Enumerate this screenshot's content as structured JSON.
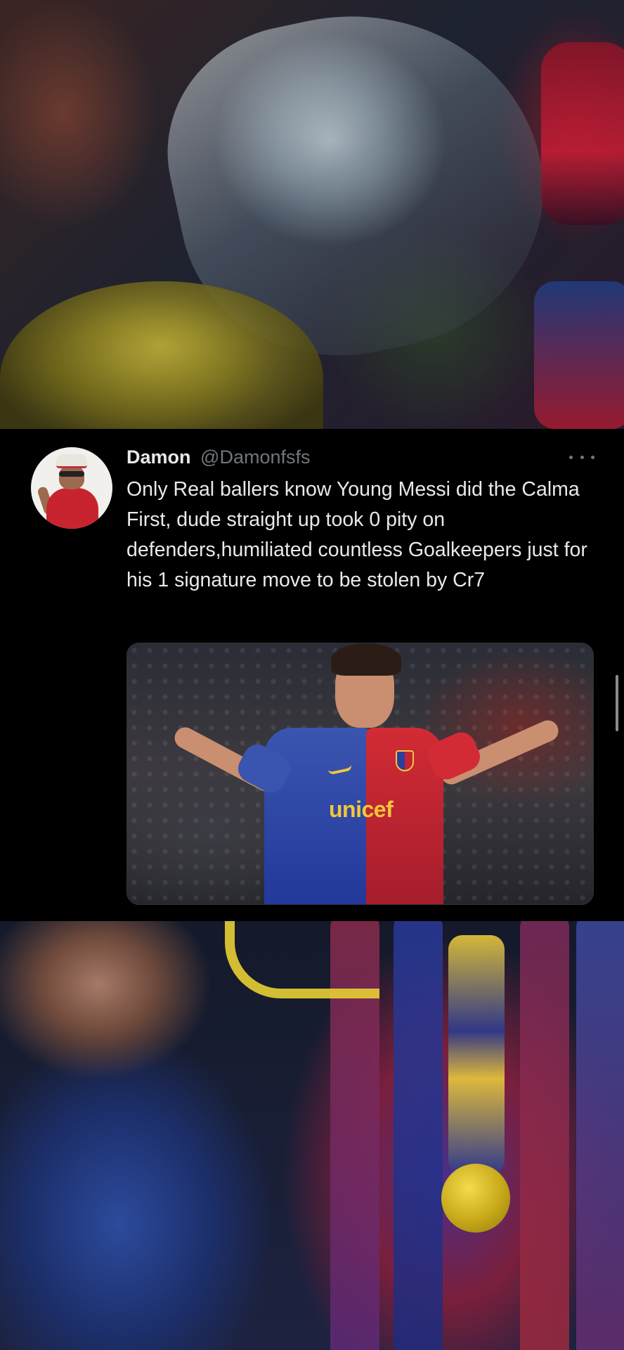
{
  "tweet": {
    "author_name": "Damon",
    "author_handle": "@Damonfsfs",
    "text": "Only Real ballers know Young Messi did the Calma First, dude straight up took 0 pity on defenders,humiliated countless Goalkeepers just for his 1 signature move to be stolen by Cr7",
    "media": {
      "sponsor_text": "unicef"
    }
  },
  "icons": {
    "more": "more-horizontal-icon"
  }
}
